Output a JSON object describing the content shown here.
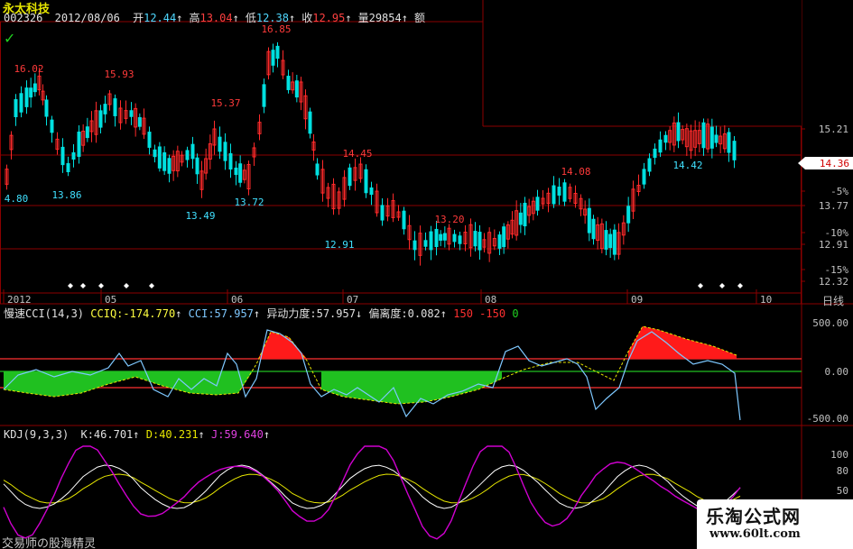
{
  "stock": {
    "name": "永太科技",
    "code": "002326",
    "date": "2012/08/06"
  },
  "quote": [
    {
      "label": "开",
      "value": "12.44",
      "arrow": "↑",
      "color": "#4fd8ff"
    },
    {
      "label": "高",
      "value": "13.04",
      "arrow": "↑",
      "color": "#ff4040"
    },
    {
      "label": "低",
      "value": "12.38",
      "arrow": "↑",
      "color": "#4fd8ff"
    },
    {
      "label": "收",
      "value": "12.95",
      "arrow": "↑",
      "color": "#ff4040"
    },
    {
      "label": "量",
      "value": "29854",
      "arrow": "↑",
      "color": "#e0e0e0"
    },
    {
      "label": "额",
      "value": "",
      "arrow": "",
      "color": "#e0e0e0"
    }
  ],
  "price_labels": [
    {
      "text": "16.85",
      "color": "red"
    },
    {
      "text": "16.02",
      "color": "red"
    },
    {
      "text": "15.93",
      "color": "red"
    },
    {
      "text": "15.37",
      "color": "red"
    },
    {
      "text": "14.45",
      "color": "red"
    },
    {
      "text": "14.08",
      "color": "red"
    },
    {
      "text": "13.20",
      "color": "red"
    },
    {
      "text": "4.80",
      "color": "cyan"
    },
    {
      "text": "13.86",
      "color": "cyan"
    },
    {
      "text": "13.49",
      "color": "cyan"
    },
    {
      "text": "13.72",
      "color": "cyan"
    },
    {
      "text": "12.91",
      "color": "cyan"
    },
    {
      "text": "14.42",
      "color": "cyan"
    }
  ],
  "month_labels": [
    "2012",
    "05",
    "06",
    "07",
    "08",
    "09",
    "10"
  ],
  "right_axis": [
    "15.21",
    "-5%",
    "13.77",
    "-10%",
    "12.91",
    "-15%",
    "12.32"
  ],
  "current_price": "14.36",
  "period_label": "日线",
  "cci": {
    "name": "慢速CCI(14,3)",
    "cciq": "CCIQ:-174.770",
    "cciq_arrow": "↑",
    "cci": "CCI:57.957",
    "cci_arrow": "↑",
    "force": "异动力度:57.957",
    "force_arrow": "↓",
    "dev": "偏离度:0.082",
    "dev_arrow": "↑",
    "l150": "150",
    "lm150": "-150",
    "l0": "0",
    "axis": [
      "500.00",
      "0.00",
      "-500.00"
    ]
  },
  "kdj": {
    "name": "KDJ(9,3,3)",
    "k": "K:46.701",
    "k_arrow": "↑",
    "d": "D:40.231",
    "d_arrow": "↑",
    "j": "J:59.640",
    "j_arrow": "↑",
    "axis": [
      "100",
      "80",
      "50"
    ]
  },
  "footer": "交易师の股海精灵",
  "watermark": {
    "name": "乐淘公式网",
    "url": "www.60lt.com"
  },
  "colors": {
    "up": "#ff2a2a",
    "down": "#00e0e0",
    "grid": "#8b0000",
    "axis": "#a0a0a0",
    "cci_line": "#7ec8ff",
    "green": "#20c020",
    "kline": "#e0e0e0",
    "dline": "#e6e600",
    "jline": "#d000d0"
  }
}
